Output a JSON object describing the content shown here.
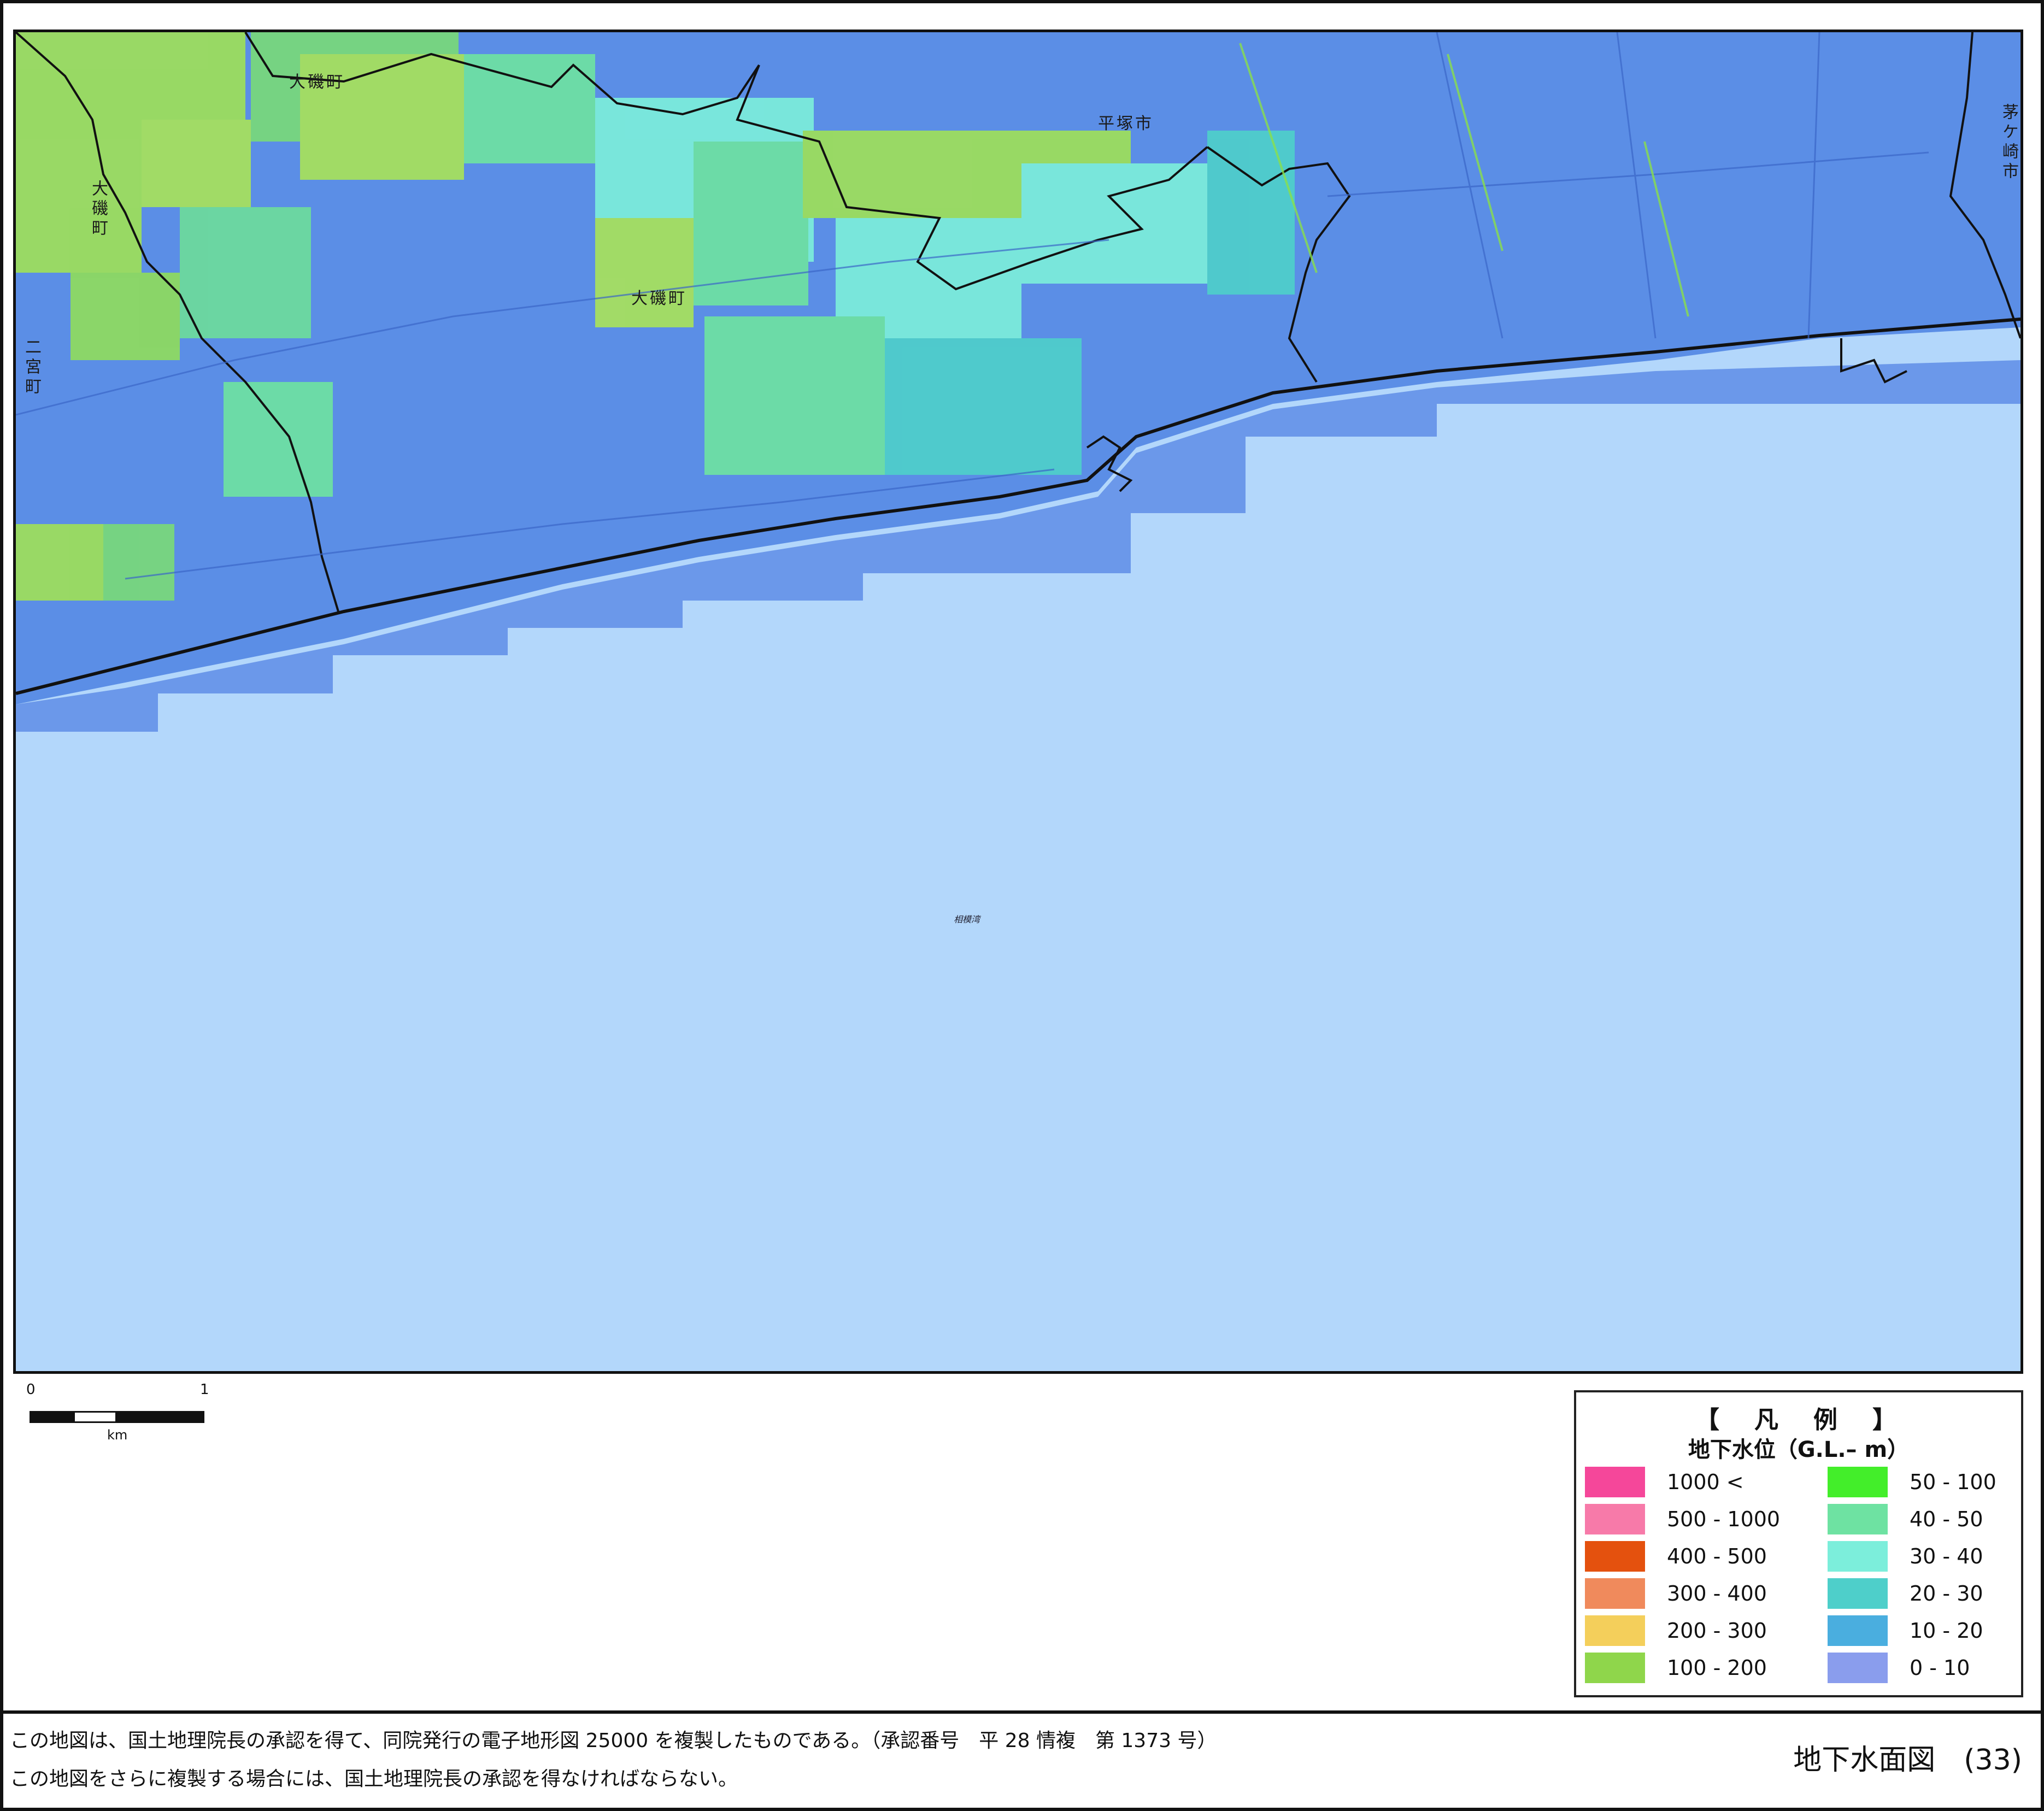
{
  "map": {
    "place_labels": {
      "oiso_town_top": "大磯町",
      "oiso_town_left": "大磯町",
      "oiso_town_center": "大磯町",
      "hiratsuka_city": "平塚市",
      "ninomiya_town": "二宮町",
      "chigasaki_city": "茅ケ崎市",
      "sagami_bay": "相模湾"
    }
  },
  "scalebar": {
    "start": "0",
    "end": "1",
    "unit": "km"
  },
  "legend": {
    "title": "【　凡　例　】",
    "subtitle": "地下水位（G.L.– m）",
    "items": [
      {
        "label": "1000 <",
        "color": "#f5479a"
      },
      {
        "label": "500 - 1000",
        "color": "#f77aa9"
      },
      {
        "label": "400 - 500",
        "color": "#e4510e"
      },
      {
        "label": "300 - 400",
        "color": "#f08a5c"
      },
      {
        "label": "200 - 300",
        "color": "#f4cf5b"
      },
      {
        "label": "100 - 200",
        "color": "#8fd64b"
      },
      {
        "label": "50 - 100",
        "color": "#43ee2a"
      },
      {
        "label": "40 - 50",
        "color": "#6ee2a2"
      },
      {
        "label": "30 - 40",
        "color": "#7ceedb"
      },
      {
        "label": "20 - 30",
        "color": "#4ecfca"
      },
      {
        "label": "10 - 20",
        "color": "#4aaedf"
      },
      {
        "label": "0 - 10",
        "color": "#8a9ded"
      }
    ]
  },
  "footer": {
    "note_line1": "この地図は、国土地理院長の承認を得て、同院発行の電子地形図 25000 を複製したものである。（承認番号　平 28 情複　第 1373 号）",
    "note_line2": "この地図をさらに複製する場合には、国土地理院長の承認を得なければならない。",
    "sheet_title": "地下水面図　(33)"
  }
}
